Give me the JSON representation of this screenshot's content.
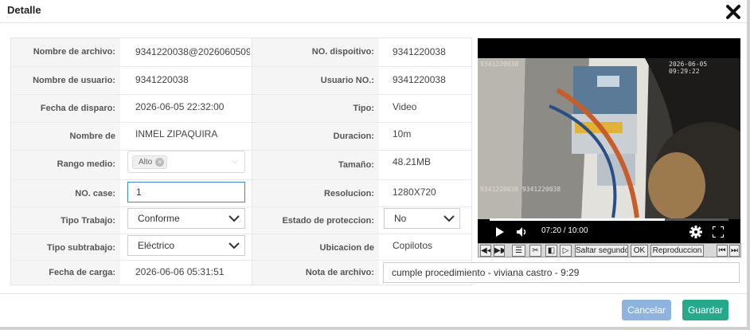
{
  "dialog": {
    "title": "Detalle"
  },
  "fields": {
    "nombre_archivo": {
      "label": "Nombre de archivo:",
      "value": "9341220038@2026060509"
    },
    "no_dispositivo": {
      "label": "NO. dispoitivo:",
      "value": "9341220038"
    },
    "nombre_usuario": {
      "label": "Nombre de usuario:",
      "value": "9341220038"
    },
    "usuario_no": {
      "label": "Usuario NO.:",
      "value": "9341220038"
    },
    "fecha_disparo": {
      "label": "Fecha de disparo:",
      "value": "2026-06-05 22:32:00"
    },
    "tipo": {
      "label": "Tipo:",
      "value": "Video"
    },
    "departamento": {
      "label": "Nombre de Departamento:",
      "value": "INMEL ZIPAQUIRA"
    },
    "duracion": {
      "label": "Duracion:",
      "value": "10m"
    },
    "rango_medio": {
      "label": "Rango medio:",
      "tag": "Alto"
    },
    "tamano": {
      "label": "Tamaño:",
      "value": "48.21MB"
    },
    "no_case": {
      "label": "NO. case:",
      "value": "1"
    },
    "resolucion": {
      "label": "Resolucion:",
      "value": "1280X720"
    },
    "tipo_trabajo": {
      "label": "Tipo Trabajo:",
      "value": "Conforme"
    },
    "estado_proteccion": {
      "label": "Estado de proteccion:",
      "value": "No"
    },
    "tipo_subtrabajo": {
      "label": "Tipo subtrabajo:",
      "value": "Eléctrico"
    },
    "ubicacion": {
      "label": "Ubicacion de almacenamiento:",
      "value": "Copilotos"
    },
    "fecha_carga": {
      "label": "Fecha de carga:",
      "value": "2026-06-06 05:31:51"
    },
    "nota": {
      "label": "Nota de archivo:",
      "value": "cumple procedimiento - viviana castro - 9:29"
    }
  },
  "player": {
    "overlay_left": "9341220038",
    "overlay_right": "2026-06-05 09:29:22",
    "overlay_bottom": "9341220038 9341220038",
    "time": "07:20 / 10:00",
    "progress": 0.733,
    "toolbar": {
      "saltar": "Saltar segundo",
      "ok": "OK",
      "reproduccion": "Reproduccion"
    }
  },
  "footer": {
    "cancel": "Cancelar",
    "save": "Guardar"
  }
}
